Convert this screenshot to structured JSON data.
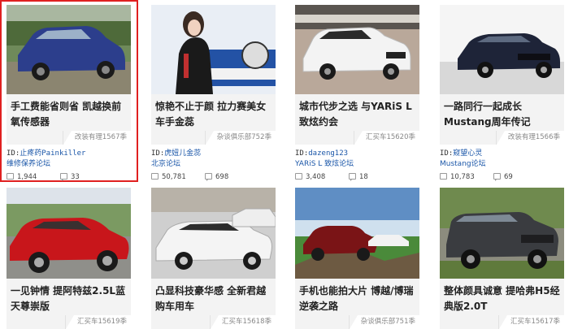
{
  "selection_color": "#e02020",
  "cards": [
    {
      "title": "手工费能省则省 凯越换前氧传感器",
      "issue": "改装有理1567季",
      "id_label": "ID:",
      "author": "止疼药Painkiller",
      "forum": "维修保养论坛",
      "views": "1,944",
      "comments": "33"
    },
    {
      "title": "惊艳不止于颜 拉力赛美女车手金蕊",
      "issue": "杂谈俱乐部752季",
      "id_label": "ID:",
      "author": "虎妞儿金蕊",
      "forum": "北京论坛",
      "views": "50,781",
      "comments": "698"
    },
    {
      "title": "城市代步之选 与YARiS L 致炫约会",
      "issue": "汇买车15620季",
      "id_label": "ID:",
      "author": "dazeng123",
      "forum": "YARiS L 致炫论坛",
      "views": "3,408",
      "comments": "18"
    },
    {
      "title": "一路同行一起成长 Mustang周年传记",
      "issue": "改装有理1566季",
      "id_label": "ID:",
      "author": "窥望心灵",
      "forum": "Mustang论坛",
      "views": "10,783",
      "comments": "69"
    },
    {
      "title": "一见钟情 提阿特兹2.5L蓝天尊崇版",
      "issue": "汇买车15619季"
    },
    {
      "title": "凸显科技豪华感 全新君越购车用车",
      "issue": "汇买车15618季"
    },
    {
      "title": "手机也能拍大片 博越/博瑞逆袭之路",
      "issue": "杂谈俱乐部751季"
    },
    {
      "title": "整体颜具诚意 提哈弗H5经典版2.0T",
      "issue": "汇买车15617季"
    }
  ]
}
